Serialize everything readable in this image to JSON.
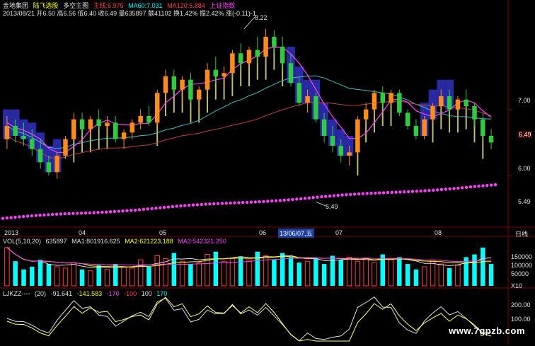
{
  "header": {
    "line1": {
      "prefix": "金地集团",
      "items": [
        {
          "text": "陆飞选股",
          "color": "#ffff00"
        },
        {
          "text": "多空主图",
          "color": "#e0e0e0"
        },
        {
          "text": "主线:6.975",
          "color": "#ff4040"
        },
        {
          "text": "MA60:7.031",
          "color": "#00ffff"
        },
        {
          "text": "MA120:6.884",
          "color": "#ff4040"
        },
        {
          "text": "上证指数",
          "color": "#ff40ff"
        }
      ]
    },
    "line2": "2013/08/21 开6.50 高6.56 低6.40 收6.49 量635897 额41102 换1.42% 振2.42% 涨(-0.11)-1",
    "vol_header": {
      "label": "VOL(5,10,20)",
      "value": "635897",
      "ma1": "MA1:801916.625",
      "ma2": "MA2:621223.188",
      "ma3": "MA3:542321.250"
    },
    "ind_header": {
      "label": "LJKZZ----",
      "params": "(20)",
      "v1": "-91.641",
      "v2": "-141.583",
      "v3": "-170",
      "v4": "-100",
      "v5": "100",
      "v6": "170"
    }
  },
  "price_axis": {
    "ticks": [
      "7.00",
      "6.49",
      "6.00",
      "5.49"
    ],
    "current": "6.49"
  },
  "vol_axis": {
    "ticks": [
      "150000",
      "100000",
      "50000",
      "X10"
    ]
  },
  "ind_axis": {
    "ticks": [
      "200.00",
      "100.00"
    ]
  },
  "time_axis": {
    "labels": [
      "2013",
      "04",
      "05",
      "06",
      "13/06/07,五",
      "07",
      "08"
    ],
    "right_label": "日线"
  },
  "annotations": {
    "high": "8.22",
    "low": "5.49"
  },
  "watermark": "www.7gpzb.com",
  "colors": {
    "up": "#ff4040",
    "down": "#00ffff",
    "bg": "#000000",
    "grid": "#800000",
    "ma_cyan": "#40c0c0",
    "ma_red": "#c04040",
    "dots": "#ff40ff",
    "blue_fill": "#3030c0",
    "ind_white": "#e0e0e0",
    "ind_yellow": "#ffff80"
  },
  "chart_data": {
    "type": "candlestick",
    "title": "金地集团 多空主图",
    "ylim": [
      5.25,
      8.4
    ],
    "candles": [
      [
        6.55,
        6.9,
        6.4,
        6.75
      ],
      [
        6.75,
        6.85,
        6.5,
        6.6
      ],
      [
        6.6,
        6.8,
        6.45,
        6.55
      ],
      [
        6.55,
        6.7,
        6.3,
        6.4
      ],
      [
        6.4,
        6.55,
        6.1,
        6.2
      ],
      [
        6.2,
        6.3,
        6.0,
        6.05
      ],
      [
        6.05,
        6.35,
        5.95,
        6.3
      ],
      [
        6.3,
        6.6,
        6.25,
        6.55
      ],
      [
        6.55,
        6.95,
        6.5,
        6.85
      ],
      [
        6.85,
        6.95,
        6.6,
        6.7
      ],
      [
        6.7,
        6.9,
        6.6,
        6.85
      ],
      [
        6.85,
        7.0,
        6.7,
        6.75
      ],
      [
        6.75,
        6.9,
        6.6,
        6.8
      ],
      [
        6.8,
        6.9,
        6.5,
        6.55
      ],
      [
        6.55,
        6.7,
        6.4,
        6.65
      ],
      [
        6.65,
        6.85,
        6.55,
        6.8
      ],
      [
        6.8,
        7.0,
        6.7,
        6.9
      ],
      [
        6.9,
        7.05,
        6.75,
        6.8
      ],
      [
        6.8,
        7.3,
        6.75,
        7.25
      ],
      [
        7.25,
        7.6,
        7.15,
        7.5
      ],
      [
        7.5,
        7.6,
        7.2,
        7.3
      ],
      [
        7.3,
        7.5,
        7.1,
        7.45
      ],
      [
        7.45,
        7.55,
        7.1,
        7.15
      ],
      [
        7.15,
        7.35,
        7.0,
        7.3
      ],
      [
        7.3,
        7.7,
        7.2,
        7.6
      ],
      [
        7.6,
        7.8,
        7.4,
        7.5
      ],
      [
        7.5,
        7.65,
        7.35,
        7.55
      ],
      [
        7.55,
        7.9,
        7.5,
        7.85
      ],
      [
        7.85,
        8.0,
        7.6,
        7.7
      ],
      [
        7.7,
        7.95,
        7.6,
        7.9
      ],
      [
        7.9,
        8.1,
        7.7,
        7.8
      ],
      [
        7.8,
        8.22,
        7.75,
        8.1
      ],
      [
        8.1,
        8.2,
        7.85,
        7.95
      ],
      [
        7.95,
        8.1,
        7.6,
        7.7
      ],
      [
        7.7,
        7.85,
        7.35,
        7.4
      ],
      [
        7.4,
        7.5,
        7.05,
        7.1
      ],
      [
        7.1,
        7.3,
        6.95,
        7.2
      ],
      [
        7.2,
        7.25,
        6.8,
        6.85
      ],
      [
        6.85,
        6.95,
        6.5,
        6.6
      ],
      [
        6.6,
        6.75,
        6.35,
        6.45
      ],
      [
        6.45,
        6.55,
        6.2,
        6.3
      ],
      [
        6.3,
        6.45,
        6.15,
        6.35
      ],
      [
        6.35,
        6.9,
        6.3,
        6.85
      ],
      [
        6.85,
        7.1,
        6.8,
        7.0
      ],
      [
        7.0,
        7.3,
        6.9,
        7.25
      ],
      [
        7.25,
        7.35,
        7.0,
        7.1
      ],
      [
        7.1,
        7.3,
        7.05,
        7.25
      ],
      [
        7.25,
        7.3,
        6.9,
        6.95
      ],
      [
        6.95,
        7.0,
        6.7,
        6.75
      ],
      [
        6.75,
        6.85,
        6.55,
        6.6
      ],
      [
        6.6,
        6.9,
        6.55,
        6.85
      ],
      [
        6.85,
        7.1,
        6.8,
        7.05
      ],
      [
        7.05,
        7.3,
        7.0,
        7.2
      ],
      [
        7.2,
        7.3,
        6.95,
        7.0
      ],
      [
        7.0,
        7.2,
        6.9,
        7.15
      ],
      [
        7.15,
        7.3,
        7.0,
        7.05
      ],
      [
        7.05,
        7.1,
        6.75,
        6.85
      ],
      [
        6.85,
        6.95,
        6.55,
        6.6
      ],
      [
        6.6,
        6.7,
        6.4,
        6.5
      ]
    ],
    "volumes": [
      140,
      90,
      60,
      70,
      95,
      80,
      70,
      65,
      85,
      60,
      55,
      75,
      60,
      80,
      70,
      65,
      95,
      70,
      110,
      100,
      120,
      90,
      80,
      85,
      115,
      125,
      90,
      100,
      105,
      95,
      125,
      110,
      95,
      120,
      105,
      85,
      90,
      100,
      80,
      110,
      95,
      105,
      90,
      100,
      85,
      115,
      95,
      105,
      80,
      60,
      70,
      95,
      80,
      65,
      75,
      105,
      115,
      140,
      80
    ]
  }
}
